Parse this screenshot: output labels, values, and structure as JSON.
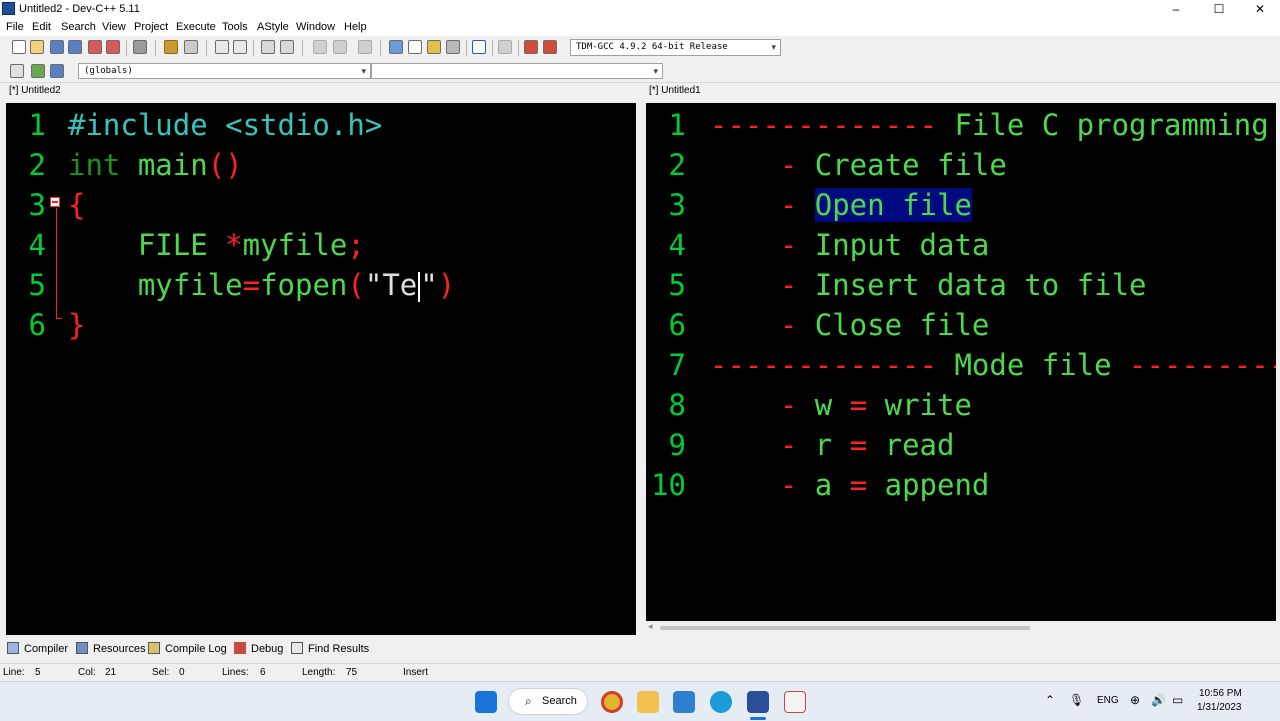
{
  "window": {
    "title": "Untitled2 - Dev-C++ 5.11",
    "minimize": "–",
    "maximize": "☐",
    "close": "✕"
  },
  "menu": [
    "File",
    "Edit",
    "Search",
    "View",
    "Project",
    "Execute",
    "Tools",
    "AStyle",
    "Window",
    "Help"
  ],
  "toolbar": {
    "compiler_select": "TDM-GCC 4.9.2 64-bit Release",
    "class_scope_select": "(globals)",
    "member_select": ""
  },
  "left_editor": {
    "tab": "[*] Untitled2",
    "lines": [
      {
        "num": "1",
        "parts": [
          {
            "t": "#include <stdio.h>",
            "c": "pp"
          }
        ]
      },
      {
        "num": "2",
        "parts": [
          {
            "t": "int",
            "c": "kw"
          },
          {
            "t": " main",
            "c": "ctext"
          },
          {
            "t": "()",
            "c": "sym"
          }
        ]
      },
      {
        "num": "3",
        "parts": [
          {
            "t": "{",
            "c": "sym"
          }
        ]
      },
      {
        "num": "4",
        "parts": [
          {
            "t": "    FILE ",
            "c": "ctext"
          },
          {
            "t": "*",
            "c": "sym"
          },
          {
            "t": "myfile",
            "c": "ctext"
          },
          {
            "t": ";",
            "c": "sym"
          }
        ]
      },
      {
        "num": "5",
        "parts": [
          {
            "t": "    myfile",
            "c": "ctext"
          },
          {
            "t": "=",
            "c": "sym"
          },
          {
            "t": "fopen",
            "c": "ctext"
          },
          {
            "t": "(",
            "c": "sym"
          },
          {
            "t": "\"Te",
            "c": "str"
          },
          {
            "t": "|",
            "c": "caret"
          },
          {
            "t": "\"",
            "c": "str"
          },
          {
            "t": ")",
            "c": "sym"
          }
        ]
      },
      {
        "num": "6",
        "parts": [
          {
            "t": "}",
            "c": "sym"
          }
        ]
      }
    ]
  },
  "right_editor": {
    "tab": "[*] Untitled1",
    "lines": [
      {
        "num": "1",
        "parts": [
          {
            "t": "------------- ",
            "c": "sym"
          },
          {
            "t": "File C programming",
            "c": "ctext"
          }
        ]
      },
      {
        "num": "2",
        "parts": [
          {
            "t": "    - ",
            "c": "sym"
          },
          {
            "t": "Create file",
            "c": "ctext"
          }
        ]
      },
      {
        "num": "3",
        "parts": [
          {
            "t": "    - ",
            "c": "sym"
          },
          {
            "t": "Open file",
            "c": "hl"
          }
        ]
      },
      {
        "num": "4",
        "parts": [
          {
            "t": "    - ",
            "c": "sym"
          },
          {
            "t": "Input data",
            "c": "ctext"
          }
        ]
      },
      {
        "num": "5",
        "parts": [
          {
            "t": "    - ",
            "c": "sym"
          },
          {
            "t": "Insert data to file",
            "c": "ctext"
          }
        ]
      },
      {
        "num": "6",
        "parts": [
          {
            "t": "    - ",
            "c": "sym"
          },
          {
            "t": "Close file",
            "c": "ctext"
          }
        ]
      },
      {
        "num": "7",
        "parts": [
          {
            "t": "------------- ",
            "c": "sym"
          },
          {
            "t": "Mode file ",
            "c": "ctext"
          },
          {
            "t": "-------------",
            "c": "sym"
          }
        ]
      },
      {
        "num": "8",
        "parts": [
          {
            "t": "    - ",
            "c": "sym"
          },
          {
            "t": "w ",
            "c": "ctext"
          },
          {
            "t": "=",
            "c": "sym"
          },
          {
            "t": " write",
            "c": "ctext"
          }
        ]
      },
      {
        "num": "9",
        "parts": [
          {
            "t": "    - ",
            "c": "sym"
          },
          {
            "t": "r ",
            "c": "ctext"
          },
          {
            "t": "=",
            "c": "sym"
          },
          {
            "t": " read",
            "c": "ctext"
          }
        ]
      },
      {
        "num": "10",
        "parts": [
          {
            "t": "    - ",
            "c": "sym"
          },
          {
            "t": "a ",
            "c": "ctext"
          },
          {
            "t": "=",
            "c": "sym"
          },
          {
            "t": " append",
            "c": "ctext"
          }
        ]
      }
    ]
  },
  "bottom_tabs": [
    "Compiler",
    "Resources",
    "Compile Log",
    "Debug",
    "Find Results"
  ],
  "status": {
    "line_label": "Line:",
    "line_value": "5",
    "col_label": "Col:",
    "col_value": "21",
    "sel_label": "Sel:",
    "sel_value": "0",
    "lines_label": "Lines:",
    "lines_value": "6",
    "length_label": "Length:",
    "length_value": "75",
    "mode": "Insert"
  },
  "taskbar": {
    "search_label": "Search",
    "language": "ENG",
    "time": "10:56 PM",
    "date": "1/31/2023"
  },
  "colors": {
    "editor_bg": "#000000",
    "code_text": "#4cd94c",
    "preprocessor": "#35c5bd",
    "keyword": "#1f8f1f",
    "symbol": "#ff2020",
    "selection": "#000a80"
  }
}
